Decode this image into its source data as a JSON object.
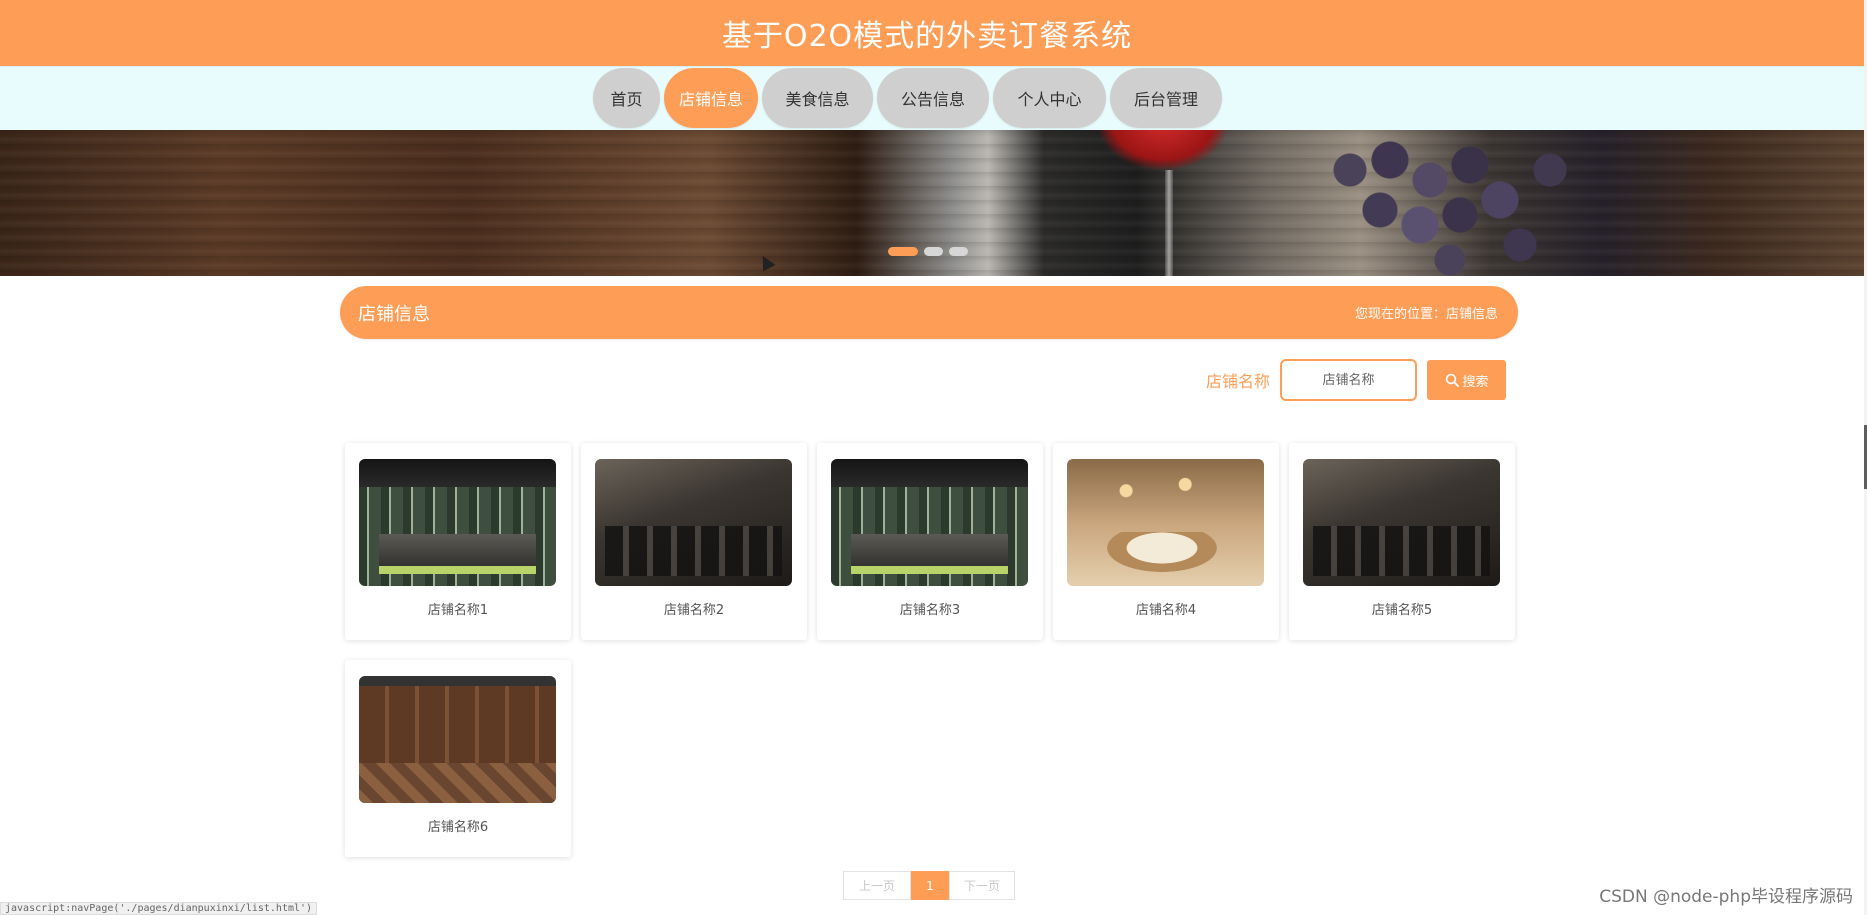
{
  "header": {
    "title": "基于O2O模式的外卖订餐系统"
  },
  "nav": {
    "items": [
      {
        "label": "首页"
      },
      {
        "label": "店铺信息"
      },
      {
        "label": "美食信息"
      },
      {
        "label": "公告信息"
      },
      {
        "label": "个人中心"
      },
      {
        "label": "后台管理"
      }
    ],
    "active": "店铺信息"
  },
  "banner": {
    "slide_count": 3,
    "active_slide": 1
  },
  "section": {
    "title": "店铺信息",
    "breadcrumb_prefix": "您现在的位置：",
    "breadcrumb_current": "店铺信息"
  },
  "search": {
    "label": "店铺名称",
    "placeholder": "店铺名称",
    "value": "",
    "button_label": "搜索",
    "button_icon": "search-icon"
  },
  "shops": [
    {
      "name": "店铺名称1"
    },
    {
      "name": "店铺名称2"
    },
    {
      "name": "店铺名称3"
    },
    {
      "name": "店铺名称4"
    },
    {
      "name": "店铺名称5"
    },
    {
      "name": "店铺名称6"
    }
  ],
  "pagination": {
    "prev_label": "上一页",
    "current_page": "1",
    "next_label": "下一页"
  },
  "status_bar": {
    "link": "javascript:navPage('./pages/dianpuxinxi/list.html')"
  },
  "watermark": "CSDN @node-php毕设程序源码",
  "colors": {
    "accent": "#fe9e56",
    "nav_bg": "#e8fcfd",
    "nav_item": "#cfcfcf"
  }
}
